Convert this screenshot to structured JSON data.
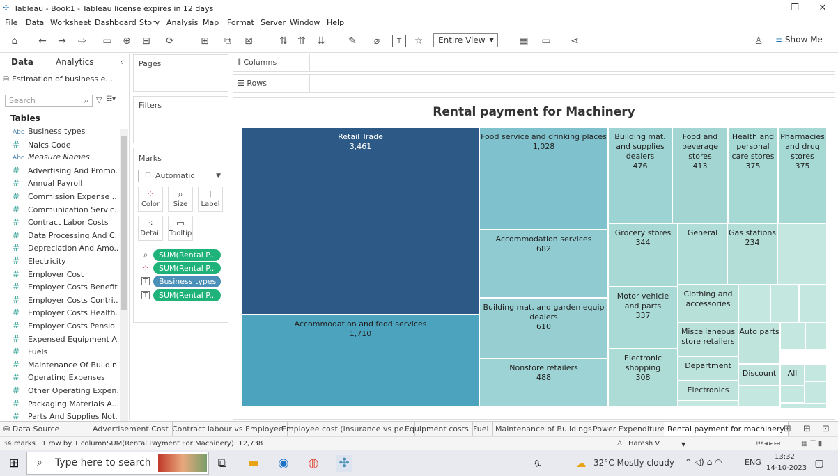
{
  "window": {
    "title": "Tableau - Book1 - Tableau license expires in 12 days"
  },
  "menu": [
    "File",
    "Data",
    "Worksheet",
    "Dashboard",
    "Story",
    "Analysis",
    "Map",
    "Format",
    "Server",
    "Window",
    "Help"
  ],
  "toolbar": {
    "view_select": "Entire View",
    "show_me": "Show Me"
  },
  "data_pane": {
    "tab_data": "Data",
    "tab_analytics": "Analytics",
    "datasource": "Estimation of business e...",
    "search_placeholder": "Search",
    "tables_heading": "Tables",
    "fields": [
      {
        "type": "Abc",
        "name": "Business types"
      },
      {
        "type": "#",
        "name": "Naics Code"
      },
      {
        "type": "Abc",
        "name": "Measure Names"
      },
      {
        "type": "#",
        "name": "Advertising And Promo..."
      },
      {
        "type": "#",
        "name": "Annual Payroll"
      },
      {
        "type": "#",
        "name": "Commission Expense ..."
      },
      {
        "type": "#",
        "name": "Communication Servic..."
      },
      {
        "type": "#",
        "name": "Contract Labor Costs"
      },
      {
        "type": "#",
        "name": "Data Processing And C..."
      },
      {
        "type": "#",
        "name": "Depreciation And Amo..."
      },
      {
        "type": "#",
        "name": "Electricity"
      },
      {
        "type": "#",
        "name": "Employer Cost"
      },
      {
        "type": "#",
        "name": "Employer Costs Benefits"
      },
      {
        "type": "#",
        "name": "Employer Costs Contri..."
      },
      {
        "type": "#",
        "name": "Employer Costs Health..."
      },
      {
        "type": "#",
        "name": "Employer Costs Pensio..."
      },
      {
        "type": "#",
        "name": "Expensed Equipment A..."
      },
      {
        "type": "#",
        "name": "Fuels"
      },
      {
        "type": "#",
        "name": "Maintenance Of Buildin..."
      },
      {
        "type": "#",
        "name": "Operating Expenses"
      },
      {
        "type": "#",
        "name": "Other Operating Expen..."
      },
      {
        "type": "#",
        "name": "Packaging Materials A..."
      },
      {
        "type": "#",
        "name": "Parts And Supplies Not..."
      }
    ]
  },
  "cards": {
    "pages": "Pages",
    "filters": "Filters",
    "marks": "Marks",
    "mark_type": "Automatic",
    "buttons": [
      "Color",
      "Size",
      "Label",
      "Detail",
      "Tooltip"
    ],
    "pills": [
      "SUM(Rental P..",
      "SUM(Rental P..",
      "Business types",
      "SUM(Rental P.."
    ]
  },
  "shelves": {
    "columns": "Columns",
    "rows": "Rows"
  },
  "viz": {
    "title": "Rental payment for Machinery",
    "cells": [
      {
        "label": "Retail Trade",
        "value": "3,461",
        "color": "#2c5985",
        "dark": true
      },
      {
        "label": "Accommodation and food services",
        "value": "1,710",
        "color": "#4ba3bd",
        "dark": false
      },
      {
        "label": "Food service and drinking places",
        "value": "1,028",
        "color": "#7fc1cc",
        "dark": false
      },
      {
        "label": "Accommodation services",
        "value": "682",
        "color": "#90cbd1",
        "dark": false
      },
      {
        "label": "Building mat. and garden equip dealers",
        "value": "610",
        "color": "#96ced2",
        "dark": false
      },
      {
        "label": "Nonstore retailers",
        "value": "488",
        "color": "#9dd3d4",
        "dark": false
      },
      {
        "label": "Building mat. and supplies dealers",
        "value": "476",
        "color": "#9ed3d3",
        "dark": false
      },
      {
        "label": "Food and beverage stores",
        "value": "413",
        "color": "#a3d6d3",
        "dark": false
      },
      {
        "label": "Health and personal care stores",
        "value": "375",
        "color": "#a6d8d4",
        "dark": false
      },
      {
        "label": "Pharmacies and drug stores",
        "value": "375",
        "color": "#a6d8d4",
        "dark": false
      },
      {
        "label": "Grocery stores",
        "value": "344",
        "color": "#a9d9d4",
        "dark": false
      },
      {
        "label": "Motor vehicle and parts",
        "value": "337",
        "color": "#aadad5",
        "dark": false
      },
      {
        "label": "Electronic shopping",
        "value": "308",
        "color": "#addbd6",
        "dark": false
      },
      {
        "label": "General",
        "value": "",
        "color": "#b0ddd7",
        "dark": false
      },
      {
        "label": "Gas stations",
        "value": "234",
        "color": "#b3ded8",
        "dark": false
      },
      {
        "label": "Clothing and accessories",
        "value": "",
        "color": "#b7e0d9",
        "dark": false
      },
      {
        "label": "Miscellaneous store retailers",
        "value": "",
        "color": "#b9e1da",
        "dark": false
      },
      {
        "label": "Department",
        "value": "",
        "color": "#bbe2db",
        "dark": false
      },
      {
        "label": "Electronics",
        "value": "",
        "color": "#bde3dc",
        "dark": false
      },
      {
        "label": "Auto parts",
        "value": "",
        "color": "#bfe4dc",
        "dark": false
      },
      {
        "label": "Discount",
        "value": "",
        "color": "#c1e5dd",
        "dark": false
      },
      {
        "label": "All",
        "value": "",
        "color": "#c2e6de",
        "dark": false
      }
    ]
  },
  "sheet_tabs": [
    "Data Source",
    "Advertisement Cost",
    "Contract labour vs Employee",
    "Employee cost (insurance vs pe...",
    "Equipment costs",
    "Fuel",
    "Maintenance of Buildings",
    "Power Expenditure",
    "Rental payment for machinery"
  ],
  "status": {
    "marks": "34 marks",
    "rows_cols": "1 row by 1 column",
    "sum": "SUM(Rental Payment For Machinery): 12,738",
    "user": "Haresh V"
  },
  "taskbar": {
    "search_placeholder": "Type here to search",
    "weather": "32°C  Mostly cloudy",
    "lang": "ENG",
    "time": "13:32",
    "date": "14-10-2023"
  }
}
